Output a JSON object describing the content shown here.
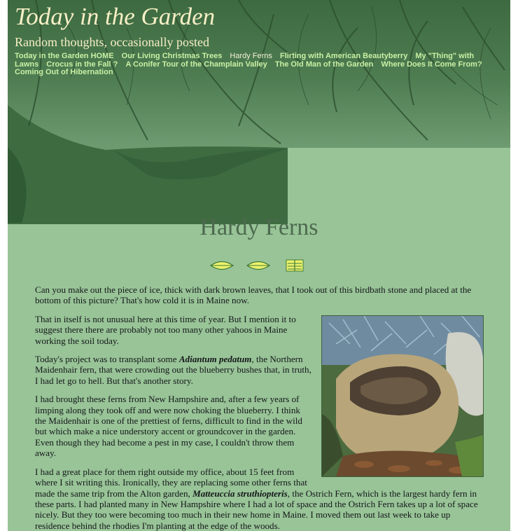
{
  "site": {
    "title": "Today in the Garden",
    "tagline": "Random thoughts, occasionally posted"
  },
  "nav": [
    "Today in the Garden HOME",
    "Our Living Christmas Trees",
    "Hardy Ferns",
    "Flirting with American Beautyberry",
    "My \"Thing\" with Lawns",
    "Crocus in the Fall ?",
    "A Conifer Tour of the Champlain Valley",
    "The Old Man of the Garden",
    "Where Does It Come From?",
    "Coming Out of Hibernation"
  ],
  "nav_current_index": 2,
  "page": {
    "title": "Hardy Ferns",
    "photo_icon": "birdbath-stone-photo",
    "paragraphs": {
      "p1": "Can you make out the piece of ice, thick with dark brown leaves, that I took out of this birdbath stone and placed at the bottom of this picture? That's how cold it is in Maine now.",
      "p2": "That in itself is not unusual here at this time of year. But I mention it to suggest there there are probably not too many other yahoos in Maine working the soil today.",
      "p3_before": "Today's project was to transplant some ",
      "p3_italic": "Adiantum pedatum",
      "p3_after": ", the Northern Maidenhair fern, that were crowding out the blueberry bushes that, in truth, I had let go to hell. But that's another story.",
      "p4": "I had brought these ferns from New Hampshire and, after a few years of limping along they took off and were now choking the blueberry. I think the Maidenhair is one of the prettiest of ferns, difficult to find in the wild but which make a nice understory accent or groundcover in the garden. Even though they had become a pest in my case, I couldn't throw them away.",
      "p5_before": "I had a great place for them right outside my office, about 15 feet from where I sit writing this. Ironically, they are replacing some other ferns that made the same trip from the Alton garden, ",
      "p5_italic": "Matteuccia struthiopteris",
      "p5_after": ", the Ostrich Fern, which is the largest hardy fern in these parts. I had planted many in New Hampshire where I had a lot of space and the Ostrich Fern takes up a lot of space nicely. But they too were becoming too much in their new home in Maine. I moved them out last week to take up residence behind the rhodies I'm planting at the edge of the woods."
    }
  },
  "colors": {
    "page_bg": "#98c497",
    "header_dark": "#3d6a40",
    "title_text": "#f7efc6",
    "nav_link": "#c9f0a5",
    "heading": "#4d6a4f"
  }
}
